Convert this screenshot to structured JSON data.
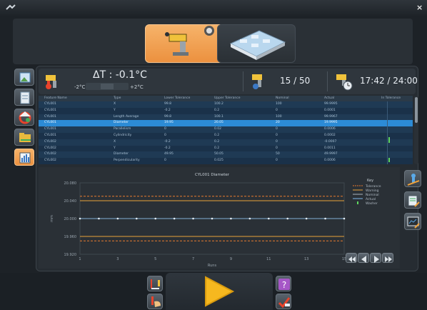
{
  "app": {
    "close_glyph": "×"
  },
  "info": {
    "delta_label": "ΔT : -0.1°C",
    "temp_left": "-2°C",
    "temp_right": "+2°C",
    "count": "15 /  50",
    "time": "17:42 /  24:00"
  },
  "table": {
    "headers": [
      "Feature Name",
      "Type",
      "Lower Tolerance",
      "Upper Tolerance",
      "Nominal",
      "Actual",
      "In Tolerance"
    ],
    "rows": [
      [
        "CYL001",
        "X",
        "99.8",
        "100.2",
        "100",
        "99.9995",
        ""
      ],
      [
        "CYL001",
        "Y",
        "-0.2",
        "0.2",
        "0",
        "0.0001",
        ""
      ],
      [
        "CYL001",
        "Length Average",
        "99.8",
        "100.1",
        "100",
        "99.9967",
        ""
      ],
      [
        "CYL001",
        "Diameter",
        "19.95",
        "20.05",
        "20",
        "19.9995",
        ""
      ],
      [
        "CYL001",
        "Parallelism",
        "0",
        "0.02",
        "0",
        "0.0006",
        ""
      ],
      [
        "CYL001",
        "Cylindricity",
        "0",
        "0.2",
        "0",
        "0.0002",
        ""
      ],
      [
        "CYL002",
        "X",
        "-0.2",
        "0.2",
        "0",
        "-0.0007",
        ""
      ],
      [
        "CYL002",
        "Y",
        "-0.2",
        "0.2",
        "0",
        "0.0011",
        ""
      ],
      [
        "CYL002",
        "Diameter",
        "49.95",
        "50.05",
        "50",
        "49.9997",
        ""
      ],
      [
        "CYL002",
        "Perpendicularity",
        "0",
        "0.025",
        "0",
        "0.0006",
        ""
      ]
    ],
    "selected_index": 3
  },
  "chart_data": {
    "type": "line",
    "title": "CYL001 Diameter",
    "xlabel": "Runs",
    "ylabel": "mm",
    "xlim": [
      1,
      15
    ],
    "ylim": [
      19.92,
      20.08
    ],
    "yticks": [
      "20.080",
      "20.040",
      "20.000",
      "19.960",
      "19.920"
    ],
    "xticks": [
      "1",
      "3",
      "5",
      "7",
      "9",
      "11",
      "13",
      "15"
    ],
    "series": [
      {
        "name": "Tolerance",
        "color": "#e87a2d",
        "style": "dashed",
        "values": [
          20.05,
          20.05
        ]
      },
      {
        "name": "Warning",
        "color": "#e8a23a",
        "style": "solid",
        "values": [
          20.04,
          20.04
        ]
      },
      {
        "name": "Nominal",
        "color": "#aab4bd",
        "style": "solid",
        "values": [
          20.0,
          20.0
        ]
      },
      {
        "name": "Actual",
        "color": "#7fb8e8",
        "style": "solid",
        "x": [
          1,
          2,
          3,
          4,
          5,
          6,
          7,
          8,
          9,
          10,
          11,
          12,
          13,
          14,
          15
        ],
        "values": [
          20.0,
          20.0,
          20.0,
          20.0,
          20.0,
          20.0,
          20.0,
          20.0,
          20.0,
          20.0,
          20.0,
          20.0,
          20.0,
          20.0,
          20.0
        ]
      },
      {
        "name": "Washer",
        "color": "#5fd65f",
        "style": "marker",
        "values": []
      }
    ],
    "lower_lines": [
      19.96,
      19.95
    ],
    "legend_title": "Key",
    "legend_position": "top-right"
  },
  "colors": {
    "accent": "#ec913f",
    "selected_row": "#2c8bd6"
  },
  "icons": {
    "play": "play-icon"
  }
}
